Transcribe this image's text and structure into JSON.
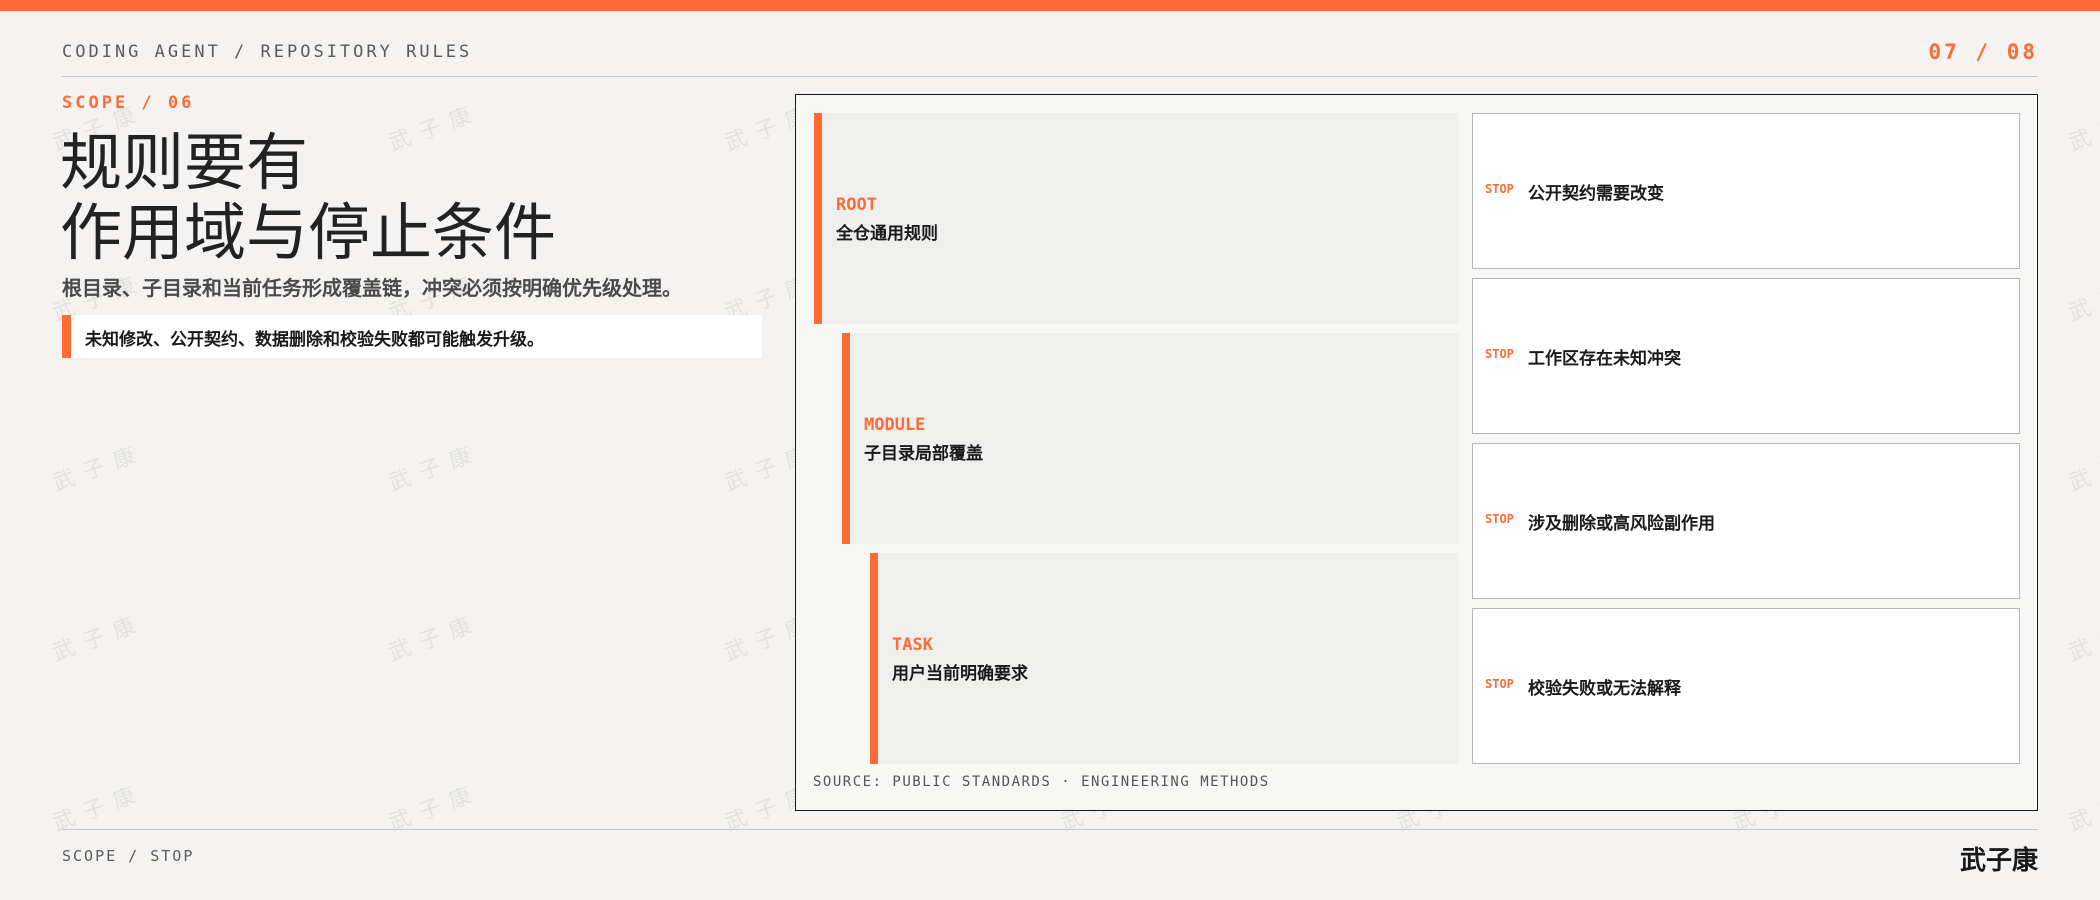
{
  "header": {
    "breadcrumb": "CODING AGENT / REPOSITORY RULES",
    "page_number": "07 / 08"
  },
  "section_label": "SCOPE / 06",
  "title_lines": [
    "规则要有",
    "作用域与停止条件"
  ],
  "subtitle": "根目录、子目录和当前任务形成覆盖链，冲突必须按明确优先级处理。",
  "callout": "未知修改、公开契约、数据删除和校验失败都可能触发升级。",
  "levels": [
    {
      "tag": "ROOT",
      "text": "全仓通用规则"
    },
    {
      "tag": "MODULE",
      "text": "子目录局部覆盖"
    },
    {
      "tag": "TASK",
      "text": "用户当前明确要求"
    }
  ],
  "stops": [
    {
      "tag": "STOP",
      "text": "公开契约需要改变"
    },
    {
      "tag": "STOP",
      "text": "工作区存在未知冲突"
    },
    {
      "tag": "STOP",
      "text": "涉及删除或高风险副作用"
    },
    {
      "tag": "STOP",
      "text": "校验失败或无法解释"
    }
  ],
  "source": "SOURCE: PUBLIC STANDARDS · ENGINEERING METHODS",
  "footer": {
    "left": "SCOPE / STOP",
    "right": "武子康"
  },
  "watermark_text": "武子康",
  "colors": {
    "accent": "#ff6b35",
    "background": "#f4f3f1",
    "level_fill": "#efefed"
  }
}
